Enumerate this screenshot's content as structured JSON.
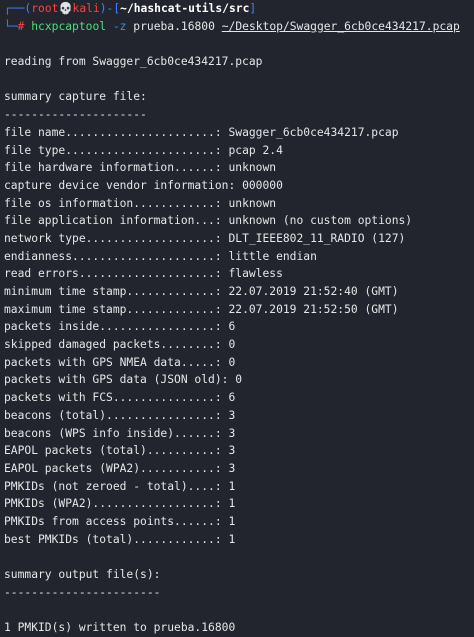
{
  "prompt": {
    "open": "┌──(",
    "user": "root",
    "skull": "💀",
    "host": "kali",
    "sep": ")-[",
    "cwd": "~/hashcat-utils/src",
    "close": "]",
    "line2_prefix": "└─",
    "hash": "#"
  },
  "command": {
    "program": "hcxpcaptool",
    "flag": "-z",
    "output": "prueba.16800",
    "input": "~/Desktop/Swagger_6cb0ce434217.pcap"
  },
  "reading": "reading from Swagger_6cb0ce434217.pcap",
  "summary_title": "summary capture file:",
  "summary_rule": "---------------------",
  "summary": [
    {
      "key": "file name......................:",
      "value": "Swagger_6cb0ce434217.pcap"
    },
    {
      "key": "file type......................:",
      "value": "pcap 2.4"
    },
    {
      "key": "file hardware information......:",
      "value": "unknown"
    },
    {
      "key": "capture device vendor information:",
      "value": "000000"
    },
    {
      "key": "file os information............:",
      "value": "unknown"
    },
    {
      "key": "file application information...:",
      "value": "unknown (no custom options)"
    },
    {
      "key": "network type...................:",
      "value": "DLT_IEEE802_11_RADIO (127)"
    },
    {
      "key": "endianness.....................:",
      "value": "little endian"
    },
    {
      "key": "read errors....................:",
      "value": "flawless"
    },
    {
      "key": "minimum time stamp.............:",
      "value": "22.07.2019 21:52:40 (GMT)"
    },
    {
      "key": "maximum time stamp.............:",
      "value": "22.07.2019 21:52:50 (GMT)"
    },
    {
      "key": "packets inside.................:",
      "value": "6"
    },
    {
      "key": "skipped damaged packets........:",
      "value": "0"
    },
    {
      "key": "packets with GPS NMEA data.....:",
      "value": "0"
    },
    {
      "key": "packets with GPS data (JSON old):",
      "value": "0"
    },
    {
      "key": "packets with FCS...............:",
      "value": "6"
    },
    {
      "key": "beacons (total)................:",
      "value": "3"
    },
    {
      "key": "beacons (WPS info inside)......:",
      "value": "3"
    },
    {
      "key": "EAPOL packets (total)..........:",
      "value": "3"
    },
    {
      "key": "EAPOL packets (WPA2)...........:",
      "value": "3"
    },
    {
      "key": "PMKIDs (not zeroed - total)....:",
      "value": "1"
    },
    {
      "key": "PMKIDs (WPA2)..................:",
      "value": "1"
    },
    {
      "key": "PMKIDs from access points......:",
      "value": "1"
    },
    {
      "key": "best PMKIDs (total)............:",
      "value": "1"
    }
  ],
  "output_title": "summary output file(s):",
  "output_rule": "-----------------------",
  "output_result": "1 PMKID(s) written to prueba.16800"
}
